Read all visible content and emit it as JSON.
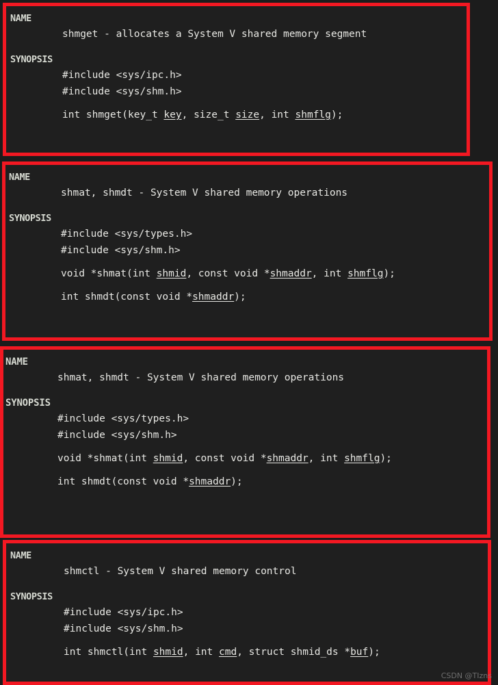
{
  "page": {
    "background_color": "#1c1c1c",
    "block_background_color": "#1f1f1f",
    "border_color": "#f31822",
    "text_color": "#e8e8e4",
    "watermark": "CSDN @TIzns"
  },
  "blocks": [
    {
      "id": "block-1",
      "name_heading": "NAME",
      "name_body": "shmget - allocates a System V shared memory segment",
      "synopsis_heading": "SYNOPSIS",
      "includes": [
        "#include <sys/ipc.h>",
        "#include <sys/shm.h>"
      ],
      "signatures": [
        {
          "parts": [
            {
              "text": "int shmget(key_t ",
              "underline": false
            },
            {
              "text": "key",
              "underline": true
            },
            {
              "text": ", size_t ",
              "underline": false
            },
            {
              "text": "size",
              "underline": true
            },
            {
              "text": ", int ",
              "underline": false
            },
            {
              "text": "shmflg",
              "underline": true
            },
            {
              "text": ");",
              "underline": false
            }
          ]
        }
      ]
    },
    {
      "id": "block-2",
      "name_heading": "NAME",
      "name_body": "shmat, shmdt - System V shared memory operations",
      "synopsis_heading": "SYNOPSIS",
      "includes": [
        "#include <sys/types.h>",
        "#include <sys/shm.h>"
      ],
      "signatures": [
        {
          "parts": [
            {
              "text": "void *shmat(int ",
              "underline": false
            },
            {
              "text": "shmid",
              "underline": true
            },
            {
              "text": ", const void *",
              "underline": false
            },
            {
              "text": "shmaddr",
              "underline": true
            },
            {
              "text": ", int ",
              "underline": false
            },
            {
              "text": "shmflg",
              "underline": true
            },
            {
              "text": ");",
              "underline": false
            }
          ]
        },
        {
          "parts": [
            {
              "text": "int shmdt(const void *",
              "underline": false
            },
            {
              "text": "shmaddr",
              "underline": true
            },
            {
              "text": ");",
              "underline": false
            }
          ]
        }
      ]
    },
    {
      "id": "block-3",
      "name_heading": "NAME",
      "name_body": "shmat, shmdt - System V shared memory operations",
      "synopsis_heading": "SYNOPSIS",
      "includes": [
        "#include <sys/types.h>",
        "#include <sys/shm.h>"
      ],
      "signatures": [
        {
          "parts": [
            {
              "text": "void *shmat(int ",
              "underline": false
            },
            {
              "text": "shmid",
              "underline": true
            },
            {
              "text": ", const void *",
              "underline": false
            },
            {
              "text": "shmaddr",
              "underline": true
            },
            {
              "text": ", int ",
              "underline": false
            },
            {
              "text": "shmflg",
              "underline": true
            },
            {
              "text": ");",
              "underline": false
            }
          ]
        },
        {
          "parts": [
            {
              "text": "int shmdt(const void *",
              "underline": false
            },
            {
              "text": "shmaddr",
              "underline": true
            },
            {
              "text": ");",
              "underline": false
            }
          ]
        }
      ]
    },
    {
      "id": "block-4",
      "name_heading": "NAME",
      "name_body": "shmctl - System V shared memory control",
      "synopsis_heading": "SYNOPSIS",
      "includes": [
        "#include <sys/ipc.h>",
        "#include <sys/shm.h>"
      ],
      "signatures": [
        {
          "parts": [
            {
              "text": "int shmctl(int ",
              "underline": false
            },
            {
              "text": "shmid",
              "underline": true
            },
            {
              "text": ", int ",
              "underline": false
            },
            {
              "text": "cmd",
              "underline": true
            },
            {
              "text": ", struct shmid_ds *",
              "underline": false
            },
            {
              "text": "buf",
              "underline": true
            },
            {
              "text": ");",
              "underline": false
            }
          ]
        }
      ]
    }
  ]
}
